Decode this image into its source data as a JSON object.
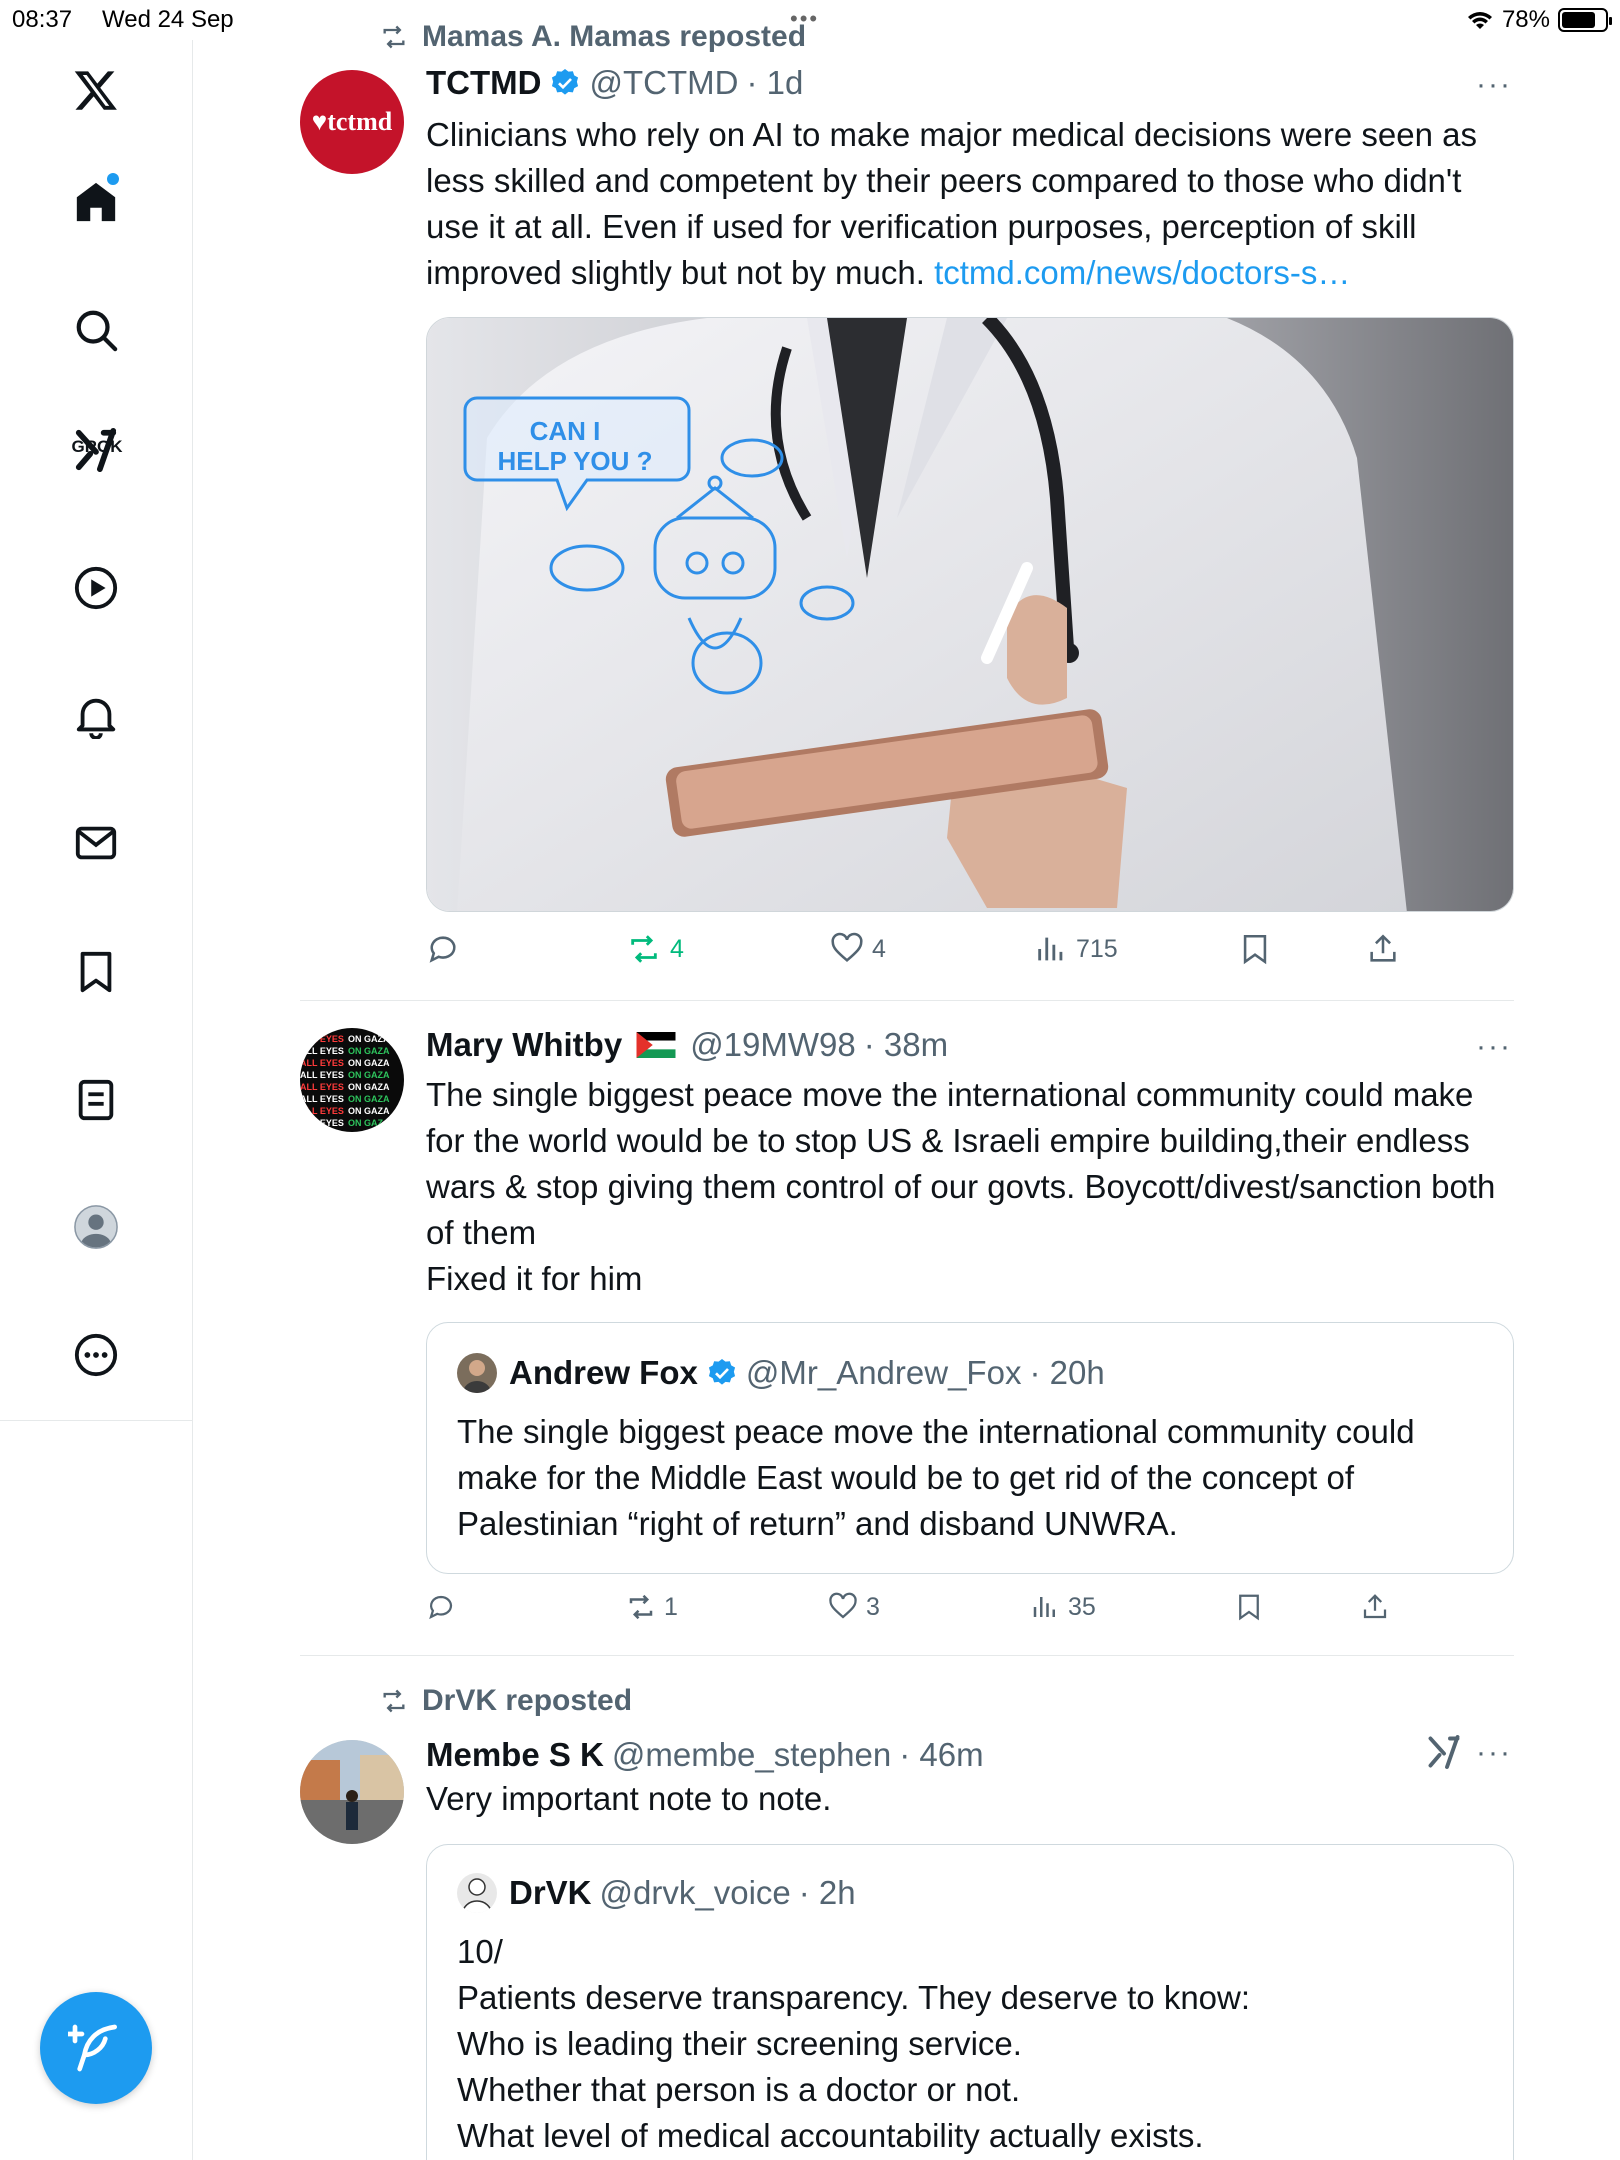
{
  "status_bar": {
    "time": "08:37",
    "date": "Wed 24 Sep",
    "battery": "78%",
    "battery_level": 0.78,
    "dots": "•••"
  },
  "sidebar": {
    "items": [
      {
        "name": "home",
        "icon": "home-icon"
      },
      {
        "name": "search",
        "icon": "search-icon"
      },
      {
        "name": "grok",
        "icon": "grok-icon",
        "label": "GROK"
      },
      {
        "name": "video",
        "icon": "play-icon"
      },
      {
        "name": "notifications",
        "icon": "bell-icon"
      },
      {
        "name": "messages",
        "icon": "mail-icon"
      },
      {
        "name": "bookmarks",
        "icon": "bookmark-icon"
      },
      {
        "name": "lists",
        "icon": "list-icon"
      },
      {
        "name": "profile",
        "icon": "profile-icon"
      },
      {
        "name": "more",
        "icon": "more-circle-icon"
      }
    ],
    "compose_icon": "compose-icon"
  },
  "posts": [
    {
      "repost_label": "Mamas A. Mamas reposted",
      "avatar_text": "♥tctmd",
      "name": "TCTMD",
      "handle": "@TCTMD",
      "time": "· 1d",
      "text": "Clinicians who rely on AI to make major medical decisions were seen as less skilled and competent by their peers compared to those who didn't use it at all. Even if used for verification purposes, perception of skill improved slightly but not by much. ",
      "link": "tctmd.com/news/doctors-s…",
      "image_text_1": "CAN I",
      "image_text_2": "HELP YOU ?",
      "actions": {
        "reply": "",
        "repost": "4",
        "like": "4",
        "views": "715"
      },
      "more": "···"
    },
    {
      "name": "Mary Whitby",
      "flag": "palestine-flag",
      "handle": "@19MW98",
      "time": "· 38m",
      "text": "The single biggest peace move the international community could make for the world would be to stop US & Israeli empire building,their endless wars & stop giving them control of our govts. Boycott/divest/sanction both of them\nFixed it for him",
      "quote": {
        "name": "Andrew Fox",
        "handle": "@Mr_Andrew_Fox",
        "time": "· 20h",
        "text": "The single biggest peace move the international community could make for the Middle East would be to get rid of the concept of Palestinian “right of return” and disband UNWRA."
      },
      "actions": {
        "reply": "",
        "repost": "1",
        "like": "3",
        "views": "35"
      },
      "more": "···"
    },
    {
      "repost_label": "DrVK reposted",
      "name": "Membe S K",
      "handle": "@membe_stephen",
      "time": "· 46m",
      "text": "Very important note to note.",
      "quote": {
        "name": "DrVK",
        "handle": "@drvk_voice",
        "time": "· 2h",
        "text": "10/\nPatients deserve transparency. They deserve to know:\nWho is leading their screening service.\nWhether that person is a doctor or not.\nWhat level of medical accountability actually exists."
      },
      "more": "···"
    }
  ],
  "colors": {
    "accent": "#1d9bf0",
    "repost_green": "#00ba7c",
    "secondary_text": "#536471"
  }
}
